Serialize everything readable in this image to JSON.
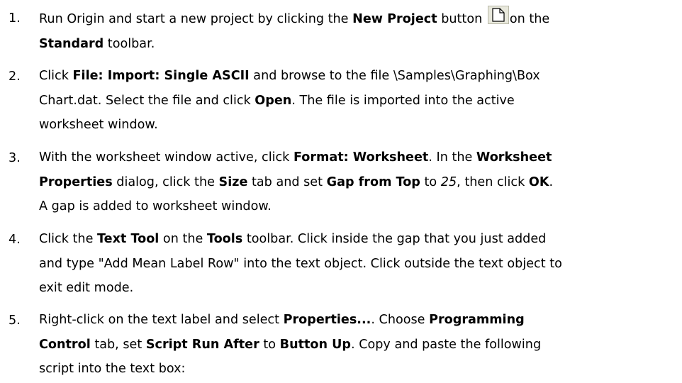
{
  "steps": [
    {
      "number": "1.",
      "lines": [
        [
          {
            "t": "Run Origin and start a new project by clicking the "
          },
          {
            "t": "New Project",
            "b": true
          },
          {
            "t": " button "
          },
          {
            "icon": "new-project-icon"
          },
          {
            "t": "on the"
          }
        ],
        [
          {
            "t": "Standard",
            "b": true
          },
          {
            "t": " toolbar."
          }
        ]
      ]
    },
    {
      "number": "2.",
      "lines": [
        [
          {
            "t": "Click "
          },
          {
            "t": "File: Import: Single ASCII",
            "b": true
          },
          {
            "t": " and browse to the file \\Samples\\Graphing\\Box"
          }
        ],
        [
          {
            "t": "Chart.dat. Select the file and click "
          },
          {
            "t": "Open",
            "b": true
          },
          {
            "t": ". The file is imported into the active"
          }
        ],
        [
          {
            "t": "worksheet window."
          }
        ]
      ]
    },
    {
      "number": "3.",
      "lines": [
        [
          {
            "t": "With the worksheet window active, click "
          },
          {
            "t": "Format: Worksheet",
            "b": true
          },
          {
            "t": ". In the "
          },
          {
            "t": "Worksheet",
            "b": true
          }
        ],
        [
          {
            "t": "Properties",
            "b": true
          },
          {
            "t": " dialog, click the "
          },
          {
            "t": "Size",
            "b": true
          },
          {
            "t": " tab and set "
          },
          {
            "t": "Gap from Top",
            "b": true
          },
          {
            "t": " to "
          },
          {
            "t": "25",
            "i": true
          },
          {
            "t": ", then click "
          },
          {
            "t": "OK",
            "b": true
          },
          {
            "t": "."
          }
        ],
        [
          {
            "t": "A gap is added to worksheet window."
          }
        ]
      ]
    },
    {
      "number": "4.",
      "lines": [
        [
          {
            "t": "Click the "
          },
          {
            "t": "Text Tool",
            "b": true
          },
          {
            "t": " on the "
          },
          {
            "t": "Tools",
            "b": true
          },
          {
            "t": " toolbar. Click inside the gap that you just added"
          }
        ],
        [
          {
            "t": "and type \"Add Mean Label Row\" into the text object. Click outside the text object to"
          }
        ],
        [
          {
            "t": "exit edit mode."
          }
        ]
      ]
    },
    {
      "number": "5.",
      "lines": [
        [
          {
            "t": "Right-click on the text label and select "
          },
          {
            "t": "Properties...",
            "b": true
          },
          {
            "t": ". Choose "
          },
          {
            "t": "Programming",
            "b": true
          }
        ],
        [
          {
            "t": "Control",
            "b": true
          },
          {
            "t": " tab, set "
          },
          {
            "t": "Script Run After",
            "b": true
          },
          {
            "t": " to "
          },
          {
            "t": "Button Up",
            "b": true
          },
          {
            "t": ". Copy and paste the following"
          }
        ],
        [
          {
            "t": "script into the text box:"
          }
        ]
      ]
    }
  ]
}
